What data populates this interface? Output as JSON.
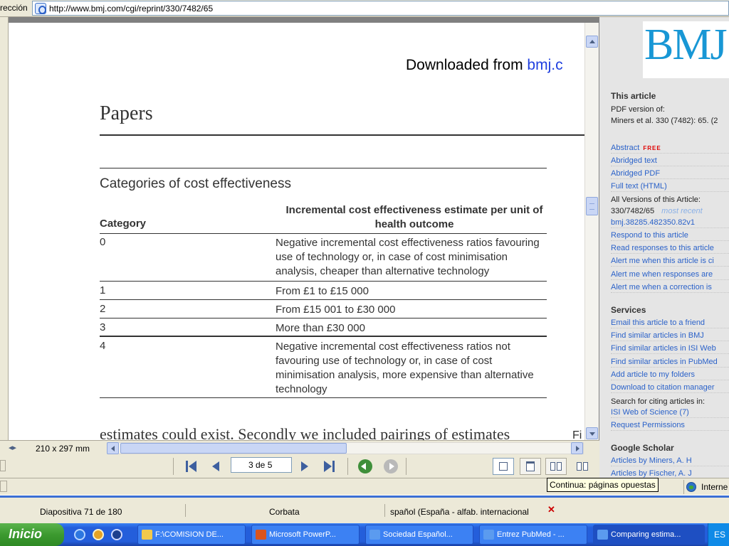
{
  "address_bar": {
    "label": "rección",
    "url": "http://www.bmj.com/cgi/reprint/330/7482/65"
  },
  "document": {
    "downloaded_prefix": "Downloaded from ",
    "downloaded_link": "bmj.c",
    "section": "Papers",
    "table_caption": "Categories of cost effectiveness",
    "col_category": "Category",
    "col_incremental": "Incremental cost effectiveness estimate per unit of health outcome",
    "rows": [
      {
        "category": "0",
        "description": "Negative incremental cost effectiveness ratios favouring use of technology or, in case of cost minimisation analysis, cheaper than alternative technology"
      },
      {
        "category": "1",
        "description": "From £1 to £15 000"
      },
      {
        "category": "2",
        "description": "From £15 001 to £30 000"
      },
      {
        "category": "3",
        "description": "More than £30 000"
      },
      {
        "category": "4",
        "description": "Negative incremental cost effectiveness ratios not favouring use of technology or, in case of cost minimisation analysis, more expensive than alternative technology"
      }
    ],
    "bottom_text": "estimates could exist. Secondly we included pairings of estimates",
    "fig_fragment": "Fi"
  },
  "viewer": {
    "page_size": "210 x 297 mm",
    "page_indicator": "3 de 5"
  },
  "sidebar": {
    "logo": "BMJ",
    "this_article_heading": "This article",
    "pdf_version_of": "PDF version of:",
    "citation": "Miners et al. 330 (7482): 65. (2",
    "links_a": {
      "abstract": "Abstract",
      "free_badge": "FREE",
      "abridged_text": "Abridged text",
      "abridged_pdf": "Abridged PDF",
      "full_text": "Full text (HTML)"
    },
    "all_versions_label": "All Versions of this Article:",
    "version_id": "330/7482/65",
    "most_recent": "most recent",
    "doi_link": "bmj.38285.482350.82v1",
    "links_b": {
      "respond": "Respond to this article",
      "read_responses": "Read responses to this article",
      "alert_cited": "Alert me when this article is ci",
      "alert_responses": "Alert me when responses are",
      "alert_correction": "Alert me when a correction is"
    },
    "services_heading": "Services",
    "services": {
      "email": "Email this article to a friend",
      "similar_bmj": "Find similar articles in BMJ",
      "similar_isi": "Find similar articles in ISI Web",
      "similar_pubmed": "Find similar articles in PubMed",
      "add_folders": "Add article to my folders",
      "download_citation": "Download to citation manager"
    },
    "search_citing": "Search for citing articles in:",
    "isi_web": "ISI Web of Science (7)",
    "request_permissions": "Request Permissions",
    "google_heading": "Google Scholar",
    "articles_miners": "Articles by Miners, A. H",
    "articles_fischer": "Articles by Fischer, A. J"
  },
  "tooltip": "Continua: páginas opuestas",
  "zone_text": "Interne",
  "ppt_status": {
    "slide": "Diapositiva 71 de 180",
    "design": "Corbata",
    "language": "spañol (España - alfab. internacional"
  },
  "taskbar": {
    "start_label": "Inicio",
    "tasks": [
      {
        "label": "F:\\COMISION DE..."
      },
      {
        "label": "Microsoft PowerP..."
      },
      {
        "label": "Sociedad Español..."
      },
      {
        "label": "Entrez PubMed - ..."
      },
      {
        "label": "Comparing estima..."
      }
    ],
    "tray_text": "ES"
  }
}
